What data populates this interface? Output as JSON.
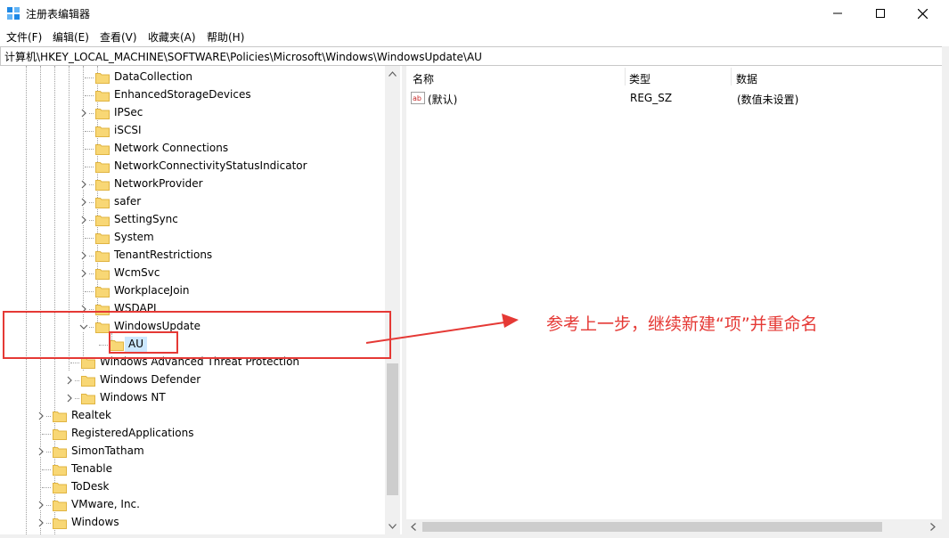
{
  "window": {
    "title": "注册表编辑器"
  },
  "menu": [
    {
      "label": "文件(F)"
    },
    {
      "label": "编辑(E)"
    },
    {
      "label": "查看(V)"
    },
    {
      "label": "收藏夹(A)"
    },
    {
      "label": "帮助(H)"
    }
  ],
  "address": "计算机\\HKEY_LOCAL_MACHINE\\SOFTWARE\\Policies\\Microsoft\\Windows\\WindowsUpdate\\AU",
  "tree": [
    {
      "label": "DataCollection",
      "expander": "none"
    },
    {
      "label": "EnhancedStorageDevices",
      "expander": "none"
    },
    {
      "label": "IPSec",
      "expander": "collapsed"
    },
    {
      "label": "iSCSI",
      "expander": "none"
    },
    {
      "label": "Network Connections",
      "expander": "none"
    },
    {
      "label": "NetworkConnectivityStatusIndicator",
      "expander": "none"
    },
    {
      "label": "NetworkProvider",
      "expander": "collapsed"
    },
    {
      "label": "safer",
      "expander": "collapsed"
    },
    {
      "label": "SettingSync",
      "expander": "collapsed"
    },
    {
      "label": "System",
      "expander": "none"
    },
    {
      "label": "TenantRestrictions",
      "expander": "collapsed"
    },
    {
      "label": "WcmSvc",
      "expander": "collapsed"
    },
    {
      "label": "WorkplaceJoin",
      "expander": "none"
    },
    {
      "label": "WSDAPI",
      "expander": "collapsed"
    },
    {
      "label": "WindowsUpdate",
      "expander": "expanded"
    },
    {
      "label": "AU",
      "expander": "none",
      "selected": true
    },
    {
      "label": "Windows Advanced Threat Protection",
      "expander": "none"
    },
    {
      "label": "Windows Defender",
      "expander": "collapsed"
    },
    {
      "label": "Windows NT",
      "expander": "collapsed"
    },
    {
      "label": "Realtek",
      "expander": "collapsed"
    },
    {
      "label": "RegisteredApplications",
      "expander": "none"
    },
    {
      "label": "SimonTatham",
      "expander": "collapsed"
    },
    {
      "label": "Tenable",
      "expander": "none"
    },
    {
      "label": "ToDesk",
      "expander": "none"
    },
    {
      "label": "VMware, Inc.",
      "expander": "collapsed"
    },
    {
      "label": "Windows",
      "expander": "collapsed"
    }
  ],
  "list": {
    "columns": [
      "名称",
      "类型",
      "数据"
    ],
    "rows": [
      {
        "name": "(默认)",
        "type": "REG_SZ",
        "data": "(数值未设置)",
        "icon": "string-value-icon"
      }
    ]
  },
  "annotation": {
    "text": "参考上一步，继续新建“项”并重命名",
    "color": "#e53935"
  },
  "colors": {
    "folder": "#f8d775",
    "folder_dark": "#e0b441",
    "selection": "#cce8ff",
    "accent": "#0078d7"
  }
}
